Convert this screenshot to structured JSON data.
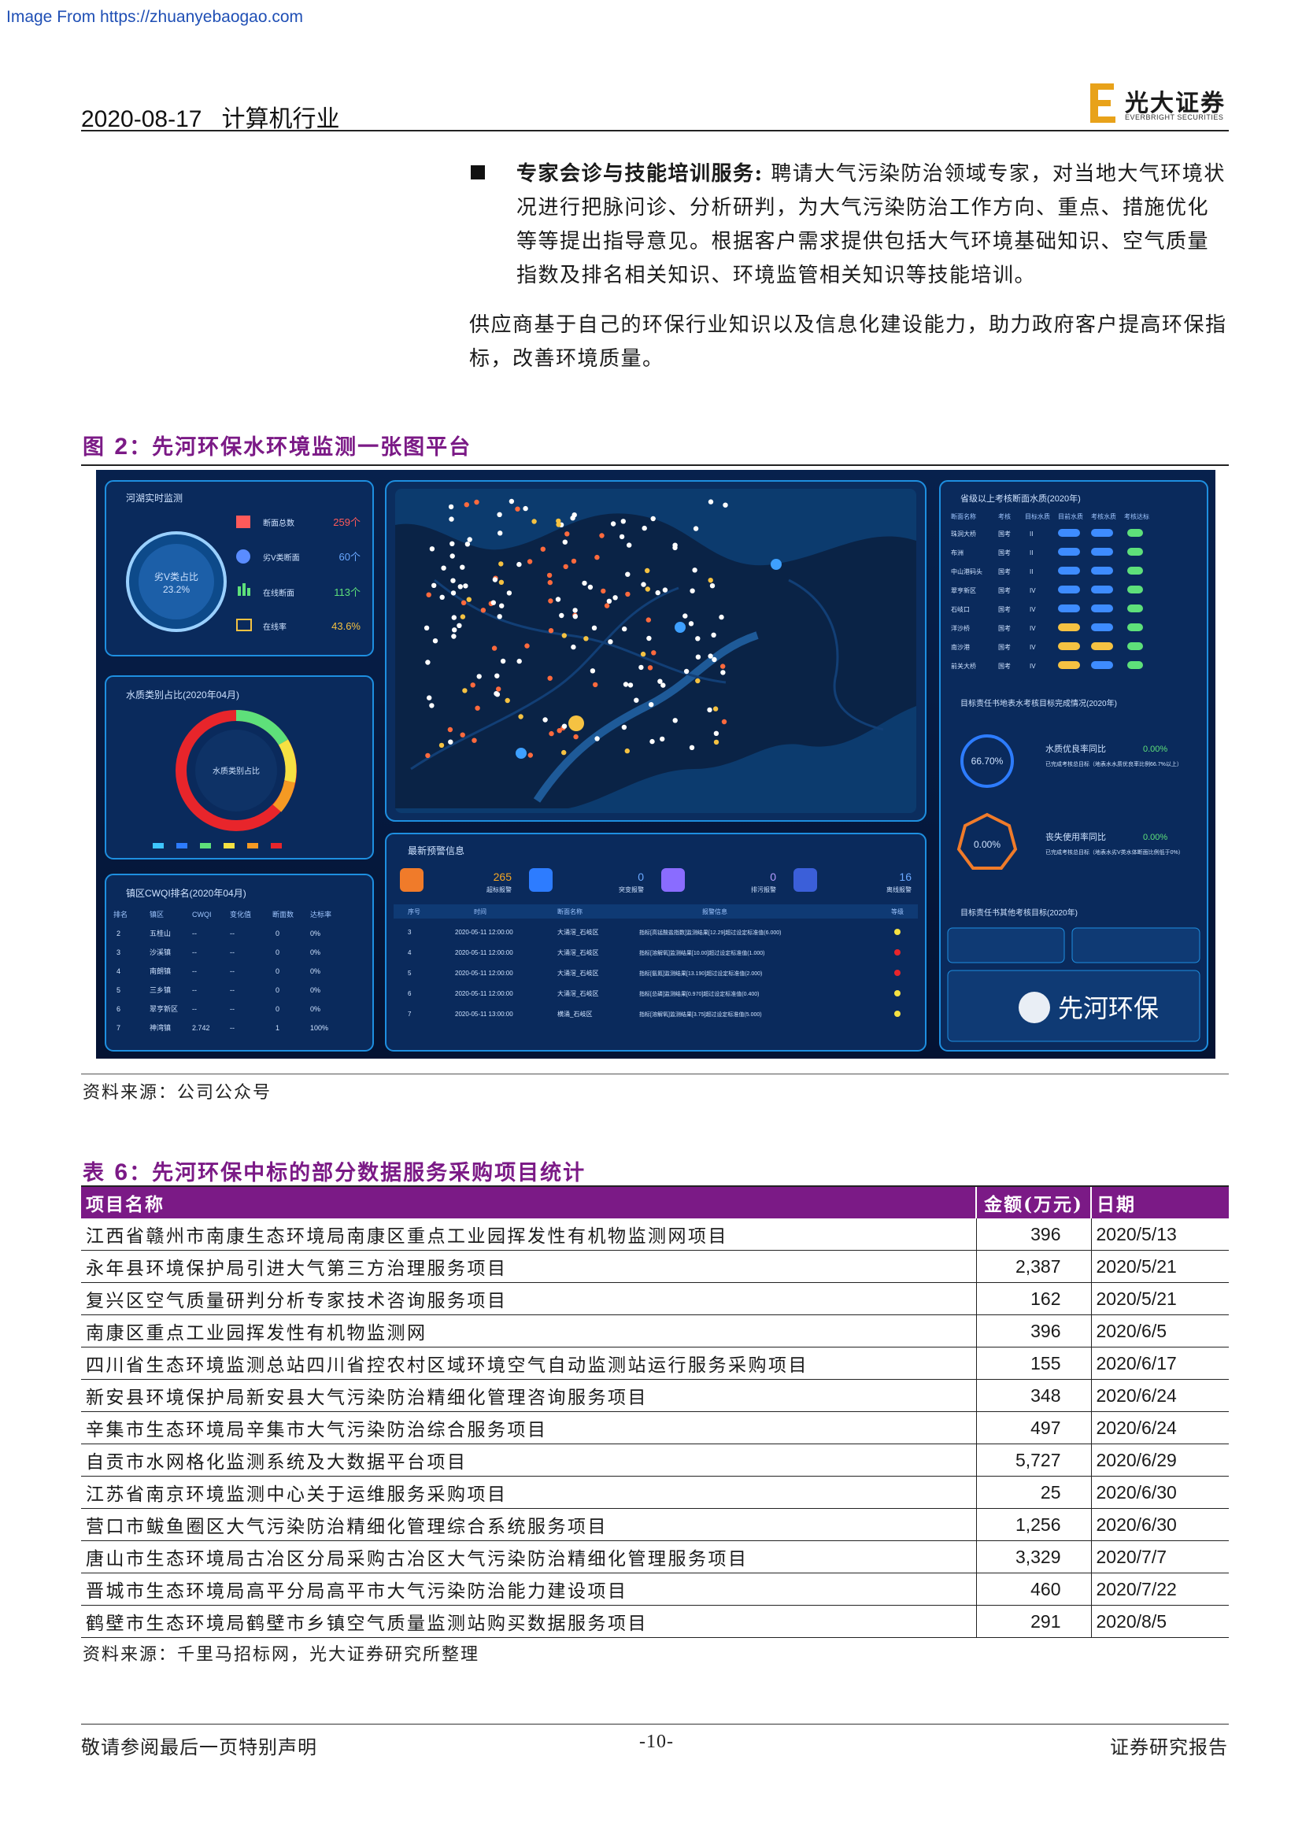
{
  "watermark": "Image From https://zhuanyebaogao.com",
  "header": {
    "date": "2020-08-17",
    "industry": "计算机行业",
    "logo_cn": "光大证券",
    "logo_en": "EVERBRIGHT SECURITIES"
  },
  "body": {
    "bullet_title": "专家会诊与技能培训服务:",
    "bullet_text": "聘请大气污染防治领域专家，对当地大气环境状况进行把脉问诊、分析研判，为大气污染防治工作方向、重点、措施优化等等提出指导意见。根据客户需求提供包括大气环境基础知识、空气质量指数及排名相关知识、环境监管相关知识等技能培训。",
    "paragraph": "供应商基于自己的环保行业知识以及信息化建设能力，助力政府客户提高环保指标，改善环境质量。"
  },
  "figure": {
    "label": "图",
    "number": "2",
    "title": "：先河环保水环境监测一张图平台",
    "source": "资料来源：公司公众号",
    "dashboard": {
      "panel1_title": "河湖实时监测",
      "gauge_label": "劣V类占比",
      "gauge_value": "23.2%",
      "stats": [
        {
          "label": "断面总数",
          "value": "259个"
        },
        {
          "label": "劣V类断面",
          "value": "60个"
        },
        {
          "label": "在线断面",
          "value": "113个"
        },
        {
          "label": "在线率",
          "value": "43.6%"
        }
      ],
      "panel2_title": "水质类别占比(2020年04月)",
      "ring_center": "水质类别占比",
      "panel3_title": "镇区CWQI排名(2020年04月)",
      "rank_headers": [
        "排名",
        "镇区",
        "CWQI",
        "变化值",
        "断面数",
        "达标率"
      ],
      "rank_rows": [
        [
          "2",
          "五桂山",
          "--",
          "--",
          "0",
          "0%"
        ],
        [
          "3",
          "沙溪镇",
          "--",
          "--",
          "0",
          "0%"
        ],
        [
          "4",
          "南朗镇",
          "--",
          "--",
          "0",
          "0%"
        ],
        [
          "5",
          "三乡镇",
          "--",
          "--",
          "0",
          "0%"
        ],
        [
          "6",
          "翠亨新区",
          "--",
          "--",
          "0",
          "0%"
        ],
        [
          "7",
          "神湾镇",
          "2.742",
          "--",
          "1",
          "100%"
        ]
      ],
      "alarm_title": "最新预警信息",
      "alarms": [
        {
          "value": "265",
          "label": "超标报警"
        },
        {
          "value": "0",
          "label": "突变报警"
        },
        {
          "value": "0",
          "label": "排污报警"
        },
        {
          "value": "16",
          "label": "离线报警"
        }
      ],
      "alarm_headers": [
        "序号",
        "时间",
        "断面名称",
        "报警信息",
        "等级"
      ],
      "alarm_rows": [
        [
          "3",
          "2020-05-11 12:00:00",
          "大涌滘_石岐区",
          "指标[高锰酸盐指数]监测结果[12.29]超过设定标准值(6.000)"
        ],
        [
          "4",
          "2020-05-11 12:00:00",
          "大涌滘_石岐区",
          "指标[溶解氧]监测结果[10.00]超过设定标准值(1.000)"
        ],
        [
          "5",
          "2020-05-11 12:00:00",
          "大涌滘_石岐区",
          "指标[氨氮]监测结果[13.190]超过设定标准值(2.000)"
        ],
        [
          "6",
          "2020-05-11 12:00:00",
          "大涌滘_石岐区",
          "指标[总磷]监测结果[0.970]超过设定标准值(0.400)"
        ],
        [
          "7",
          "2020-05-11 13:00:00",
          "横涌_石岐区",
          "指标[溶解氧]监测结果[3.75]超过设定标准值(5.000)"
        ]
      ],
      "right_title": "省级以上考核断面水质(2020年)",
      "right_headers": [
        "断面名称",
        "考核",
        "目标水质",
        "目前水质",
        "考核水质",
        "考核达标"
      ],
      "right_rows": [
        [
          "珠洞大桥",
          "国考",
          "II"
        ],
        [
          "布洲",
          "国考",
          "II"
        ],
        [
          "中山港码头",
          "国考",
          "II"
        ],
        [
          "翠亨新区",
          "国考",
          "IV"
        ],
        [
          "石岐口",
          "国考",
          "IV"
        ],
        [
          "洋沙桥",
          "国考",
          "IV"
        ],
        [
          "南沙港",
          "国考",
          "IV"
        ],
        [
          "前关大桥",
          "国考",
          "IV"
        ]
      ],
      "target_title": "目标责任书地表水考核目标完成情况(2020年)",
      "kpi1_value": "66.70%",
      "kpi1_label": "水质优良率同比",
      "kpi1_change": "0.00%",
      "kpi1_note": "已完成考核总目标（地表水水质优良率比例66.7%以上）",
      "kpi2_value": "0.00%",
      "kpi2_label": "丧失使用率同比",
      "kpi2_change": "0.00%",
      "kpi2_note": "已完成考核总目标（地表水劣V类水体断面比例低于0%）",
      "bottom_title": "目标责任书其他考核目标(2020年)",
      "brand": "先河环保"
    }
  },
  "table": {
    "label": "表",
    "number": "6",
    "title": "：先河环保中标的部分数据服务采购项目统计",
    "headers": {
      "name": "项目名称",
      "amount": "金额(万元)",
      "date": "日期"
    },
    "rows": [
      {
        "name": "江西省赣州市南康生态环境局南康区重点工业园挥发性有机物监测网项目",
        "amount": "396",
        "date": "2020/5/13"
      },
      {
        "name": "永年县环境保护局引进大气第三方治理服务项目",
        "amount": "2,387",
        "date": "2020/5/21"
      },
      {
        "name": "复兴区空气质量研判分析专家技术咨询服务项目",
        "amount": "162",
        "date": "2020/5/21"
      },
      {
        "name": "南康区重点工业园挥发性有机物监测网",
        "amount": "396",
        "date": "2020/6/5"
      },
      {
        "name": "四川省生态环境监测总站四川省控农村区域环境空气自动监测站运行服务采购项目",
        "amount": "155",
        "date": "2020/6/17"
      },
      {
        "name": "新安县环境保护局新安县大气污染防治精细化管理咨询服务项目",
        "amount": "348",
        "date": "2020/6/24"
      },
      {
        "name": "辛集市生态环境局辛集市大气污染防治综合服务项目",
        "amount": "497",
        "date": "2020/6/24"
      },
      {
        "name": "自贡市水网格化监测系统及大数据平台项目",
        "amount": "5,727",
        "date": "2020/6/29"
      },
      {
        "name": "江苏省南京环境监测中心关于运维服务采购项目",
        "amount": "25",
        "date": "2020/6/30"
      },
      {
        "name": "营口市鲅鱼圈区大气污染防治精细化管理综合系统服务项目",
        "amount": "1,256",
        "date": "2020/6/30"
      },
      {
        "name": "唐山市生态环境局古冶区分局采购古冶区大气污染防治精细化管理服务项目",
        "amount": "3,329",
        "date": "2020/7/7"
      },
      {
        "name": "晋城市生态环境局高平分局高平市大气污染防治能力建设项目",
        "amount": "460",
        "date": "2020/7/22"
      },
      {
        "name": "鹤壁市生态环境局鹤壁市乡镇空气质量监测站购买数据服务项目",
        "amount": "291",
        "date": "2020/8/5"
      }
    ],
    "source": "资料来源：千里马招标网，光大证券研究所整理"
  },
  "footer": {
    "left": "敬请参阅最后一页特别声明",
    "page": "-10-",
    "right": "证券研究报告"
  }
}
